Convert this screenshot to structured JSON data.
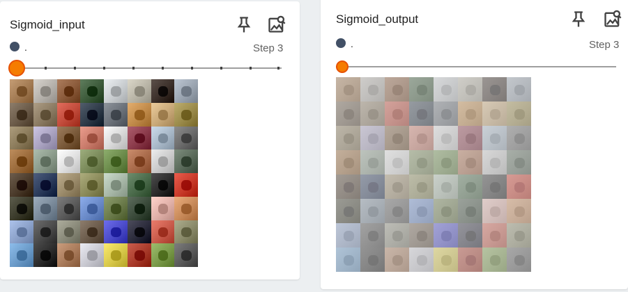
{
  "panels": [
    {
      "title": "Sigmoid_input",
      "run_label": ".",
      "step_label": "Step 3",
      "washed": false
    },
    {
      "title": "Sigmoid_output",
      "run_label": ".",
      "step_label": "Step 3",
      "washed": true
    }
  ],
  "colors": {
    "run_dot": "#425066",
    "slider_thumb": "#f57c00",
    "page_background": "#eceff1"
  },
  "icons": {
    "pin": "pin-icon",
    "download": "download-image-icon"
  },
  "image_grid": {
    "rows": 8,
    "cols": 8,
    "cells": [
      [
        "#a27a52",
        "#b5b1ab",
        "#8a5a3a",
        "#3c5a3a",
        "#c9cdd0",
        "#b8b4a6",
        "#3a2e28",
        "#9aa4b0"
      ],
      [
        "#6a5a48",
        "#8a7a62",
        "#c04a3a",
        "#2e3a48",
        "#6a7078",
        "#c08a4a",
        "#c8a878",
        "#9a8a4a"
      ],
      [
        "#8a7a5a",
        "#a9a2c0",
        "#7a5a3a",
        "#c87a6a",
        "#d8d8d8",
        "#8a3a4a",
        "#a8b8c8",
        "#6a6a6a"
      ],
      [
        "#9a6a3a",
        "#8a9a8a",
        "#e0e0e0",
        "#7a8a5a",
        "#6a8a4a",
        "#a86a4a",
        "#cacaca",
        "#5a6a5a"
      ],
      [
        "#4a3a2a",
        "#2a3a5a",
        "#9a8a6a",
        "#8a8a5a",
        "#a8b8a8",
        "#4a6a4a",
        "#2a2a2a",
        "#c83a2a"
      ],
      [
        "#3a3a2a",
        "#7a8a9a",
        "#5a5a5a",
        "#6a8ac8",
        "#6a7a4a",
        "#3a4a3a",
        "#e0b0a8",
        "#c88a5a"
      ],
      [
        "#8aa0c8",
        "#4a4a4a",
        "#8a8a7a",
        "#6a5a4a",
        "#4a4ac8",
        "#2a2a3a",
        "#c85a4a",
        "#8a8a6a"
      ],
      [
        "#6a9ac8",
        "#2a2a2a",
        "#a87a5a",
        "#c8c8d0",
        "#d8c84a",
        "#a83a2a",
        "#7a9a4a",
        "#5a5a5a"
      ]
    ]
  }
}
